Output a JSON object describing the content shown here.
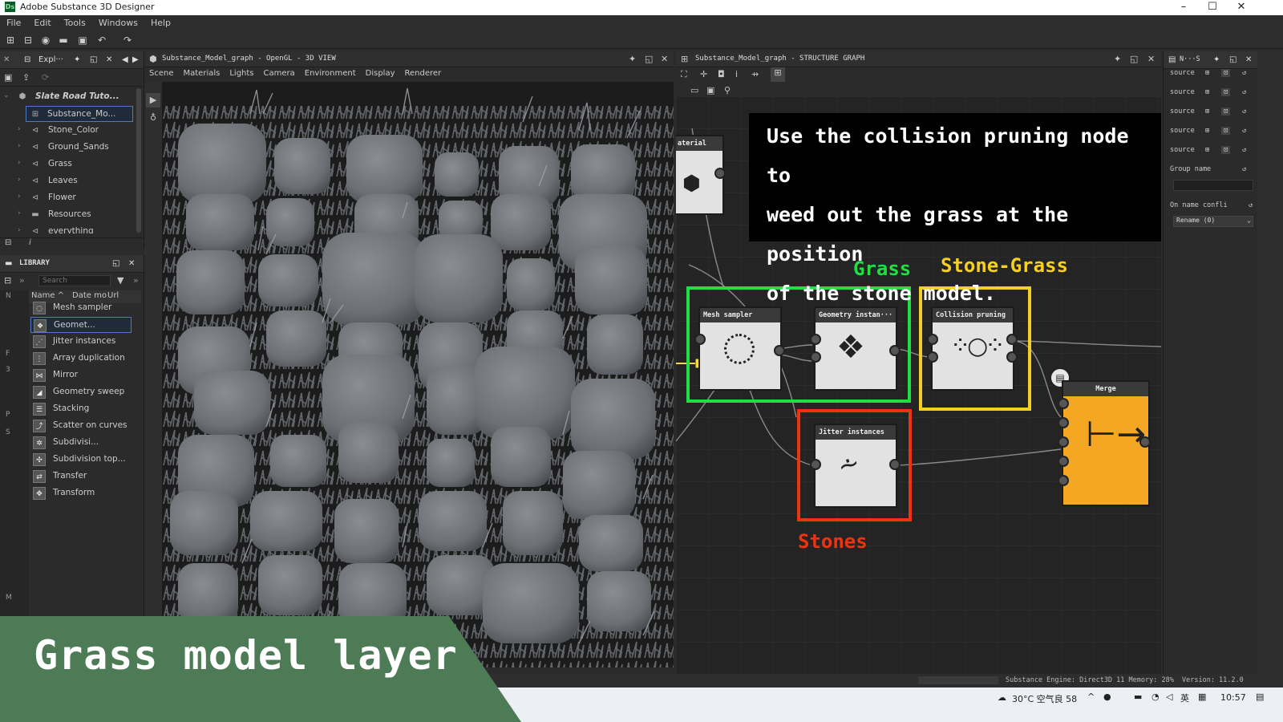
{
  "window": {
    "title": "Adobe Substance 3D Designer",
    "logo": "Ds"
  },
  "menu": [
    "File",
    "Edit",
    "Tools",
    "Windows",
    "Help"
  ],
  "explorer": {
    "tab": "Expl···",
    "package": "Slate Road Tuto...",
    "items": [
      "Substance_Mo...",
      "Stone_Color",
      "Ground_Sands",
      "Grass",
      "Leaves",
      "Flower",
      "Resources",
      "everything"
    ]
  },
  "library": {
    "title": "LIBRARY",
    "search_placeholder": "Search",
    "columns": [
      "Name ^",
      "Date mo",
      "Url"
    ],
    "items": [
      "Mesh sampler",
      "Geomet...",
      "Jitter instances",
      "Array duplication",
      "Mirror",
      "Geometry sweep",
      "Stacking",
      "Scatter on curves",
      "Subdivisi...",
      "Subdivision top...",
      "Transfer",
      "Transform"
    ],
    "side_letters": [
      "N",
      "F",
      "3",
      "P",
      "S",
      "M"
    ]
  },
  "viewport": {
    "title": "Substance_Model_graph - OpenGL - 3D VIEW",
    "menu": [
      "Scene",
      "Materials",
      "Lights",
      "Camera",
      "Environment",
      "Display",
      "Renderer"
    ]
  },
  "graph": {
    "title": "Substance_Model_graph - STRUCTURE GRAPH",
    "nodes": {
      "material": "aterial",
      "mesh_sampler": "Mesh sampler",
      "geometry_instancer": "Geometry instan···",
      "collision_pruning": "Collision pruning",
      "jitter_instances": "Jitter instances",
      "merge": "Merge"
    },
    "labels": {
      "grass": "Grass",
      "stone_grass": "Stone-Grass",
      "stones": "Stones"
    },
    "colors": {
      "grass": "#22dd44",
      "stone_grass": "#f5d020",
      "stones": "#ee3311",
      "merge": "#f5a623"
    }
  },
  "callout": {
    "line1": "Use the collision pruning node to",
    "line2": "weed out the grass at the position",
    "line3": "of the stone model."
  },
  "banner": {
    "text": "Grass model layer"
  },
  "properties": {
    "tab": "N···S",
    "rows": [
      "source",
      "source",
      "source",
      "source",
      "source"
    ],
    "group_name": "Group name",
    "on_name_conflict": "On name confli",
    "rename_option": "Rename (0)"
  },
  "status": {
    "engine": "Substance Engine: Direct3D 11 Memory: 28%",
    "version": "Version: 11.2.0"
  },
  "taskbar": {
    "weather": "30°C 空气良 58",
    "ime": "英",
    "time": "10:57"
  }
}
